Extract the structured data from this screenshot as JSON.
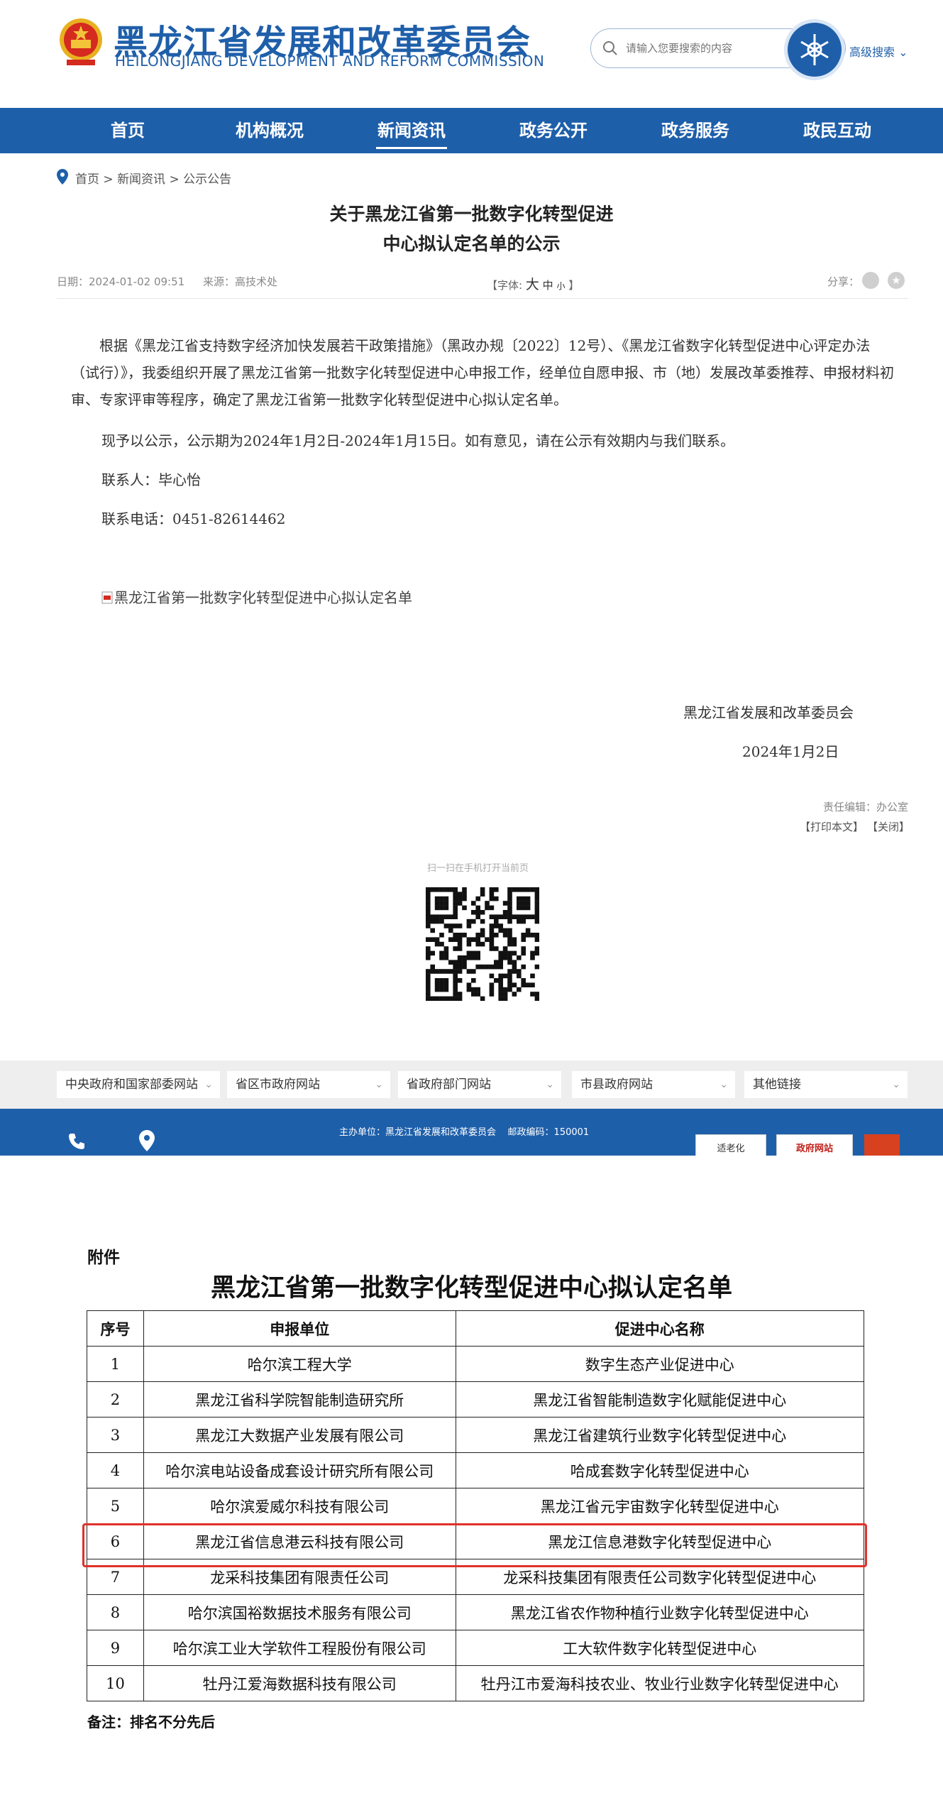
{
  "header": {
    "org_cn": "黑龙江省发展和改革委员会",
    "org_en": "HEILONGJIANG DEVELOPMENT AND REFORM COMMISSION",
    "search_placeholder": "请输入您要搜索的内容",
    "advanced_search": "高级搜索"
  },
  "nav": {
    "items": [
      "首页",
      "机构概况",
      "新闻资讯",
      "政务公开",
      "政务服务",
      "政民互动"
    ],
    "active": "新闻资讯"
  },
  "breadcrumb": {
    "home": "首页",
    "sep": ">",
    "level1": "新闻资讯",
    "level2": "公示公告"
  },
  "article": {
    "title_line1": "关于黑龙江省第一批数字化转型促进",
    "title_line2": "中心拟认定名单的公示",
    "date": "日期：2024-01-02 09:51",
    "source": "来源：高技术处",
    "font_label_open": "【字体:",
    "font_large": "大",
    "font_medium": "中",
    "font_small": "小",
    "font_label_close": "】",
    "share_label": "分享：",
    "para1": "根据《黑龙江省支持数字经济加快发展若干政策措施》（黑政办规〔2022〕12号）、《黑龙江省数字化转型促进中心评定办法（试行）》，我委组织开展了黑龙江省第一批数字化转型促进中心申报工作，经单位自愿申报、市（地）发展改革委推荐、申报材料初审、专家评审等程序，确定了黑龙江省第一批数字化转型促进中心拟认定名单。",
    "para2": "现予以公示，公示期为2024年1月2日-2024年1月15日。如有意见，请在公示有效期内与我们联系。",
    "contact": "联系人：毕心怡",
    "phone": "联系电话：0451-82614462",
    "attachment": "黑龙江省第一批数字化转型促进中心拟认定名单",
    "sign_org": "黑龙江省发展和改革委员会",
    "sign_date": "2024年1月2日",
    "editor": "责任编辑：办公室",
    "print": "【打印本文】",
    "close": "【关闭】",
    "qr_caption": "扫一扫在手机打开当前页"
  },
  "links": [
    "中央政府和国家部委网站",
    "省区市政府网站",
    "省政府部门网站",
    "市县政府网站",
    "其他链接"
  ],
  "footer": {
    "sponsor": "主办单位：黑龙江省发展和改革委员会",
    "postcode": "邮政编码：150001",
    "badge1": "适老化",
    "badge2": "政府网站"
  },
  "attachment_doc": {
    "label": "附件",
    "title": "黑龙江省第一批数字化转型促进中心拟认定名单",
    "headers": [
      "序号",
      "申报单位",
      "促进中心名称"
    ],
    "rows": [
      [
        "1",
        "哈尔滨工程大学",
        "数字生态产业促进中心"
      ],
      [
        "2",
        "黑龙江省科学院智能制造研究所",
        "黑龙江省智能制造数字化赋能促进中心"
      ],
      [
        "3",
        "黑龙江大数据产业发展有限公司",
        "黑龙江省建筑行业数字化转型促进中心"
      ],
      [
        "4",
        "哈尔滨电站设备成套设计研究所有限公司",
        "哈成套数字化转型促进中心"
      ],
      [
        "5",
        "哈尔滨爱威尔科技有限公司",
        "黑龙江省元宇宙数字化转型促进中心"
      ],
      [
        "6",
        "黑龙江省信息港云科技有限公司",
        "黑龙江信息港数字化转型促进中心"
      ],
      [
        "7",
        "龙采科技集团有限责任公司",
        "龙采科技集团有限责任公司数字化转型促进中心"
      ],
      [
        "8",
        "哈尔滨国裕数据技术服务有限公司",
        "黑龙江省农作物种植行业数字化转型促进中心"
      ],
      [
        "9",
        "哈尔滨工业大学软件工程股份有限公司",
        "工大软件数字化转型促进中心"
      ],
      [
        "10",
        "牡丹江爱海数据科技有限公司",
        "牡丹江市爱海科技农业、牧业行业数字化转型促进中心"
      ]
    ],
    "note": "备注：排名不分先后"
  },
  "colors": {
    "brand": "#1e5faa",
    "highlight": "#e0312b"
  },
  "icons": [
    "national-emblem-icon",
    "search-icon",
    "chevron-down-icon",
    "location-pin-icon",
    "share-icon",
    "star-icon",
    "pdf-icon",
    "qr-code",
    "phone-icon",
    "map-pin-icon"
  ]
}
